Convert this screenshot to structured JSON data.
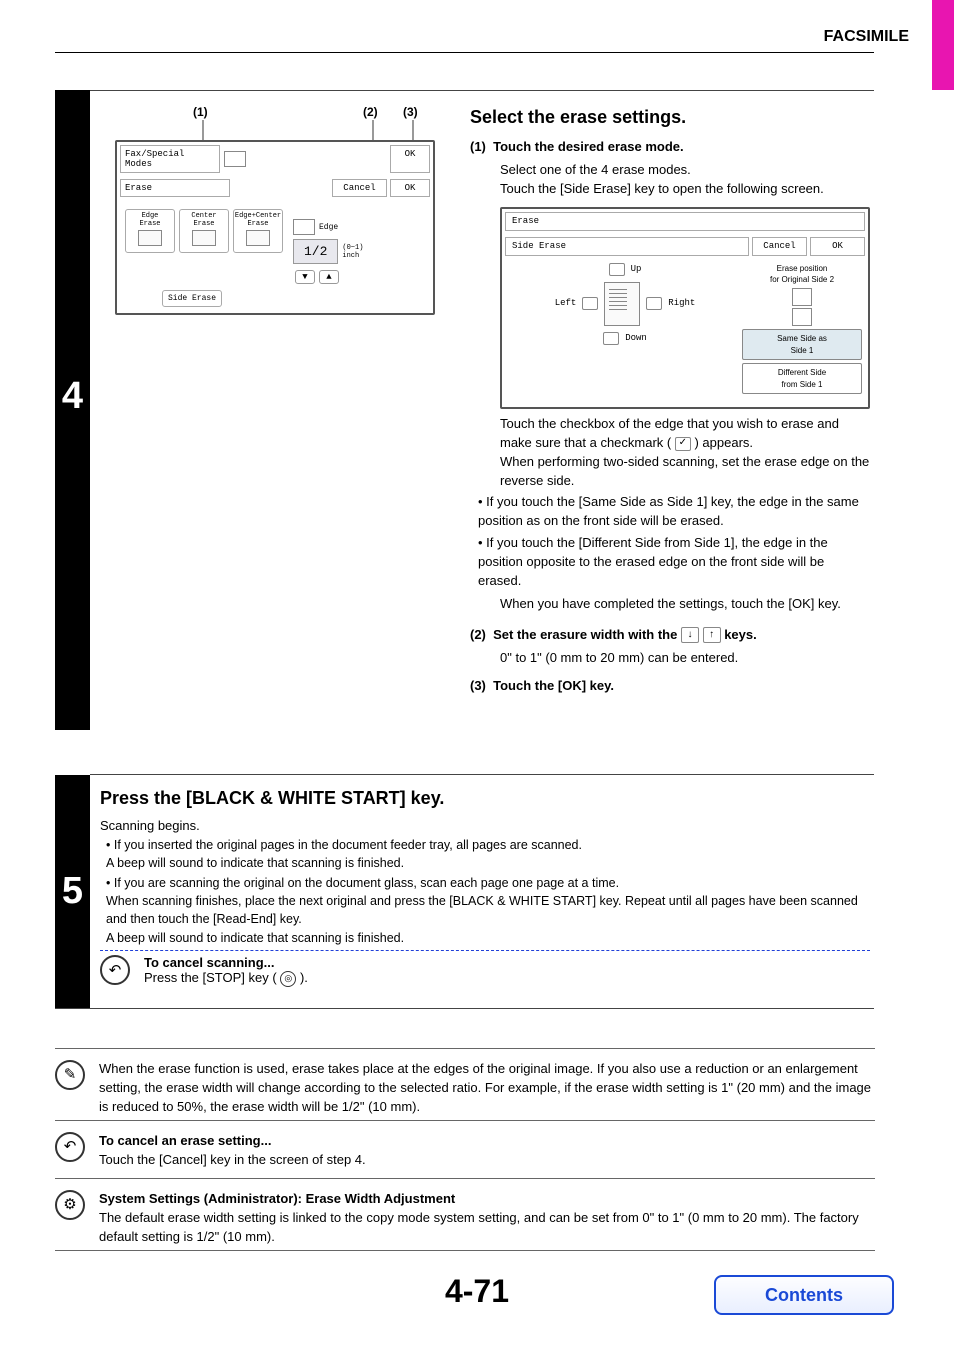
{
  "header": {
    "title": "FACSIMILE"
  },
  "step4": {
    "number": "4",
    "callouts": {
      "c1": "(1)",
      "c2": "(2)",
      "c3": "(3)"
    },
    "panel": {
      "fax_special": "Fax/Special Modes",
      "ok": "OK",
      "erase": "Erase",
      "cancel": "Cancel",
      "ok2": "OK",
      "modes": {
        "edge": "Edge\nErase",
        "center": "Center\nErase",
        "edge_center": "Edge+Center\nErase"
      },
      "edge_label": "Edge",
      "size_readout": "1/2",
      "unit": "(0~1)\ninch",
      "side_erase_btn": "Side Erase"
    },
    "right": {
      "heading": "Select the erase settings.",
      "sub1_num": "(1)",
      "sub1_title": "Touch the desired erase mode.",
      "sub1_p1": "Select one of the 4 erase modes.",
      "sub1_p2": "Touch the [Side Erase] key to open the following screen.",
      "se_panel": {
        "erase": "Erase",
        "side_erase": "Side Erase",
        "cancel": "Cancel",
        "ok": "OK",
        "up": "Up",
        "left": "Left",
        "right": "Right",
        "down": "Down",
        "pos_label": "Erase position\nfor Original Side 2",
        "opt_same": "Same Side as\nSide 1",
        "opt_diff": "Different Side\nfrom Side 1"
      },
      "after_panel_p1": "Touch the checkbox of the edge that you wish to erase and make sure that a checkmark (",
      "after_panel_p1b": ") appears.",
      "after_panel_p2": "When performing two-sided scanning, set the erase edge on the reverse side.",
      "bullets": [
        "If you touch the [Same Side as Side 1] key, the edge in the same position as on the front side will be erased.",
        "If you touch the [Different Side from Side 1], the edge in the position opposite to the erased edge on the front side will be erased."
      ],
      "after_panel_p3": "When you have completed the settings, touch the [OK] key.",
      "sub2_num": "(2)",
      "sub2_title_a": "Set the erasure width with the ",
      "sub2_title_b": " keys.",
      "sub2_p1": "0\" to 1\" (0 mm to 20 mm) can be entered.",
      "sub3_num": "(3)",
      "sub3_title": "Touch the [OK] key."
    }
  },
  "step5": {
    "number": "5",
    "heading": "Press the [BLACK & WHITE START] key.",
    "p1": "Scanning begins.",
    "bullets": [
      "If you inserted the original pages in the document feeder tray, all pages are scanned.\nA beep will sound to indicate that scanning is finished.",
      "If you are scanning the original on the document glass, scan each page one page at a time.\nWhen scanning finishes, place the next original and press the [BLACK & WHITE START] key. Repeat until all pages have been scanned and then touch the [Read-End] key.\nA beep will sound to indicate that scanning is finished."
    ],
    "cancel_title": "To cancel scanning...",
    "cancel_body_a": "Press the [STOP] key (",
    "cancel_body_b": ")."
  },
  "notes": {
    "note1": "When the erase function is used, erase takes place at the edges of the original image. If you also use a reduction or an enlargement setting, the erase width will change according to the selected ratio. For example, if the erase width setting is 1\" (20 mm) and the image is reduced to 50%, the erase width will be 1/2\" (10 mm).",
    "note2_title": "To cancel an erase setting...",
    "note2_body": "Touch the [Cancel] key in the screen of step 4.",
    "note3_title": "System Settings (Administrator): Erase Width Adjustment",
    "note3_body": "The default erase width setting is linked to the copy mode system setting, and can be set from 0\" to 1\" (0 mm to 20 mm). The factory default setting is 1/2\" (10 mm)."
  },
  "footer": {
    "page_number": "4-71",
    "contents": "Contents"
  }
}
